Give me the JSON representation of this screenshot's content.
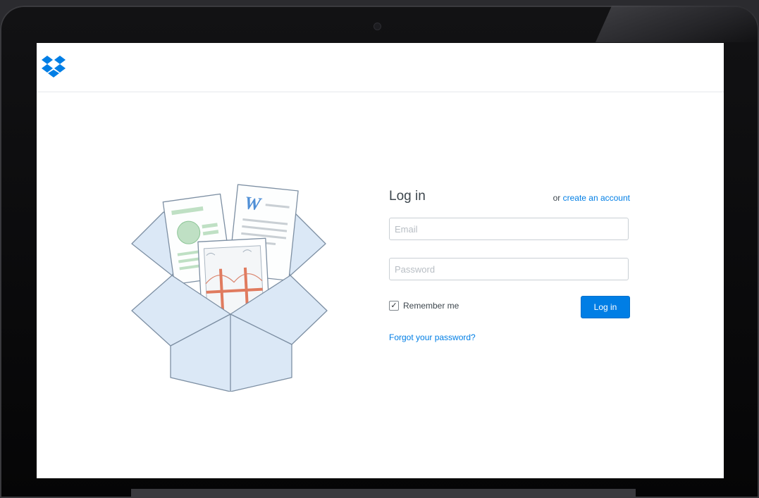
{
  "brand": {
    "logo": "dropbox-logo",
    "accent": "#007ee5"
  },
  "login": {
    "title": "Log in",
    "signup_prefix": "or",
    "signup_link": "create an account",
    "email_placeholder": "Email",
    "password_placeholder": "Password",
    "remember_label": "Remember me",
    "remember_checked": true,
    "submit_label": "Log in",
    "forgot_link": "Forgot your password?"
  },
  "illustration": {
    "icon": "open-box-with-documents-icon",
    "doc_letter": "W"
  }
}
